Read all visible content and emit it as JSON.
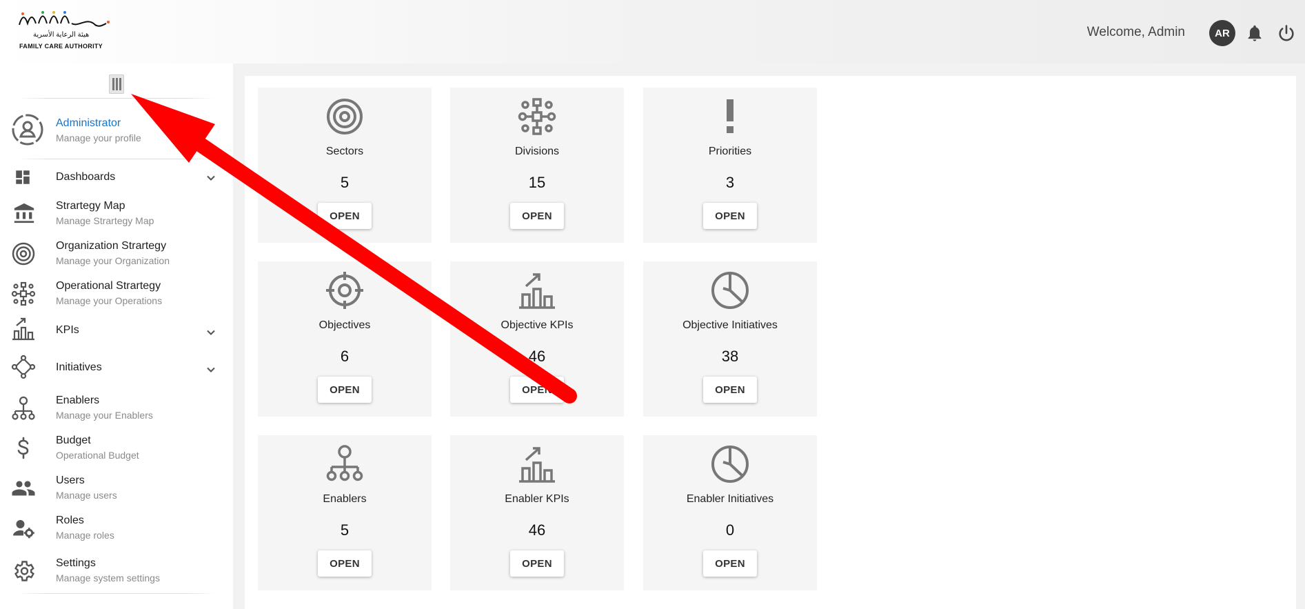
{
  "header": {
    "logo_ar": "هيئة الرعاية الأسرية",
    "logo_en": "FAMILY CARE AUTHORITY",
    "welcome": "Welcome,  Admin",
    "avatar_initials": "AR",
    "notification_icon": "bell-icon",
    "logout_icon": "power-icon"
  },
  "sidebar": {
    "items": [
      {
        "label": "Administrator",
        "sub": "Manage your profile",
        "icon": "user-circle-icon",
        "active": true
      },
      {
        "label": "Dashboards",
        "sub": "",
        "icon": "dashboard-icon",
        "expandable": true
      },
      {
        "label": "Strartegy Map",
        "sub": "Manage Strartegy Map",
        "icon": "institution-icon"
      },
      {
        "label": "Organization Strartegy",
        "sub": "Manage your Organization",
        "icon": "target-icon"
      },
      {
        "label": "Operational Strartegy",
        "sub": "Manage your Operations",
        "icon": "network-icon"
      },
      {
        "label": "KPIs",
        "sub": "",
        "icon": "kpi-chart-icon",
        "expandable": true
      },
      {
        "label": "Initiatives",
        "sub": "",
        "icon": "initiatives-icon",
        "expandable": true
      },
      {
        "label": "Enablers",
        "sub": "Manage your Enablers",
        "icon": "hierarchy-icon"
      },
      {
        "label": "Budget",
        "sub": "Operational Budget",
        "icon": "dollar-icon"
      },
      {
        "label": "Users",
        "sub": "Manage users",
        "icon": "users-icon"
      },
      {
        "label": "Roles",
        "sub": "Manage roles",
        "icon": "user-gear-icon"
      },
      {
        "label": "Settings",
        "sub": "Manage system settings",
        "icon": "gear-icon"
      }
    ]
  },
  "cards": [
    {
      "title": "Sectors",
      "count": "5",
      "button": "OPEN",
      "icon": "target-icon"
    },
    {
      "title": "Divisions",
      "count": "15",
      "button": "OPEN",
      "icon": "network-icon"
    },
    {
      "title": "Priorities",
      "count": "3",
      "button": "OPEN",
      "icon": "exclamation-icon"
    },
    {
      "title": "Objectives",
      "count": "6",
      "button": "OPEN",
      "icon": "crosshair-icon"
    },
    {
      "title": "Objective KPIs",
      "count": "46",
      "button": "OPEN",
      "icon": "kpi-chart-icon"
    },
    {
      "title": "Objective Initiatives",
      "count": "38",
      "button": "OPEN",
      "icon": "pie-icon"
    },
    {
      "title": "Enablers",
      "count": "5",
      "button": "OPEN",
      "icon": "hierarchy-icon"
    },
    {
      "title": "Enabler KPIs",
      "count": "46",
      "button": "OPEN",
      "icon": "kpi-chart-icon"
    },
    {
      "title": "Enabler Initiatives",
      "count": "0",
      "button": "OPEN",
      "icon": "pie-icon"
    }
  ],
  "annotation": {
    "color": "#ff0000"
  }
}
